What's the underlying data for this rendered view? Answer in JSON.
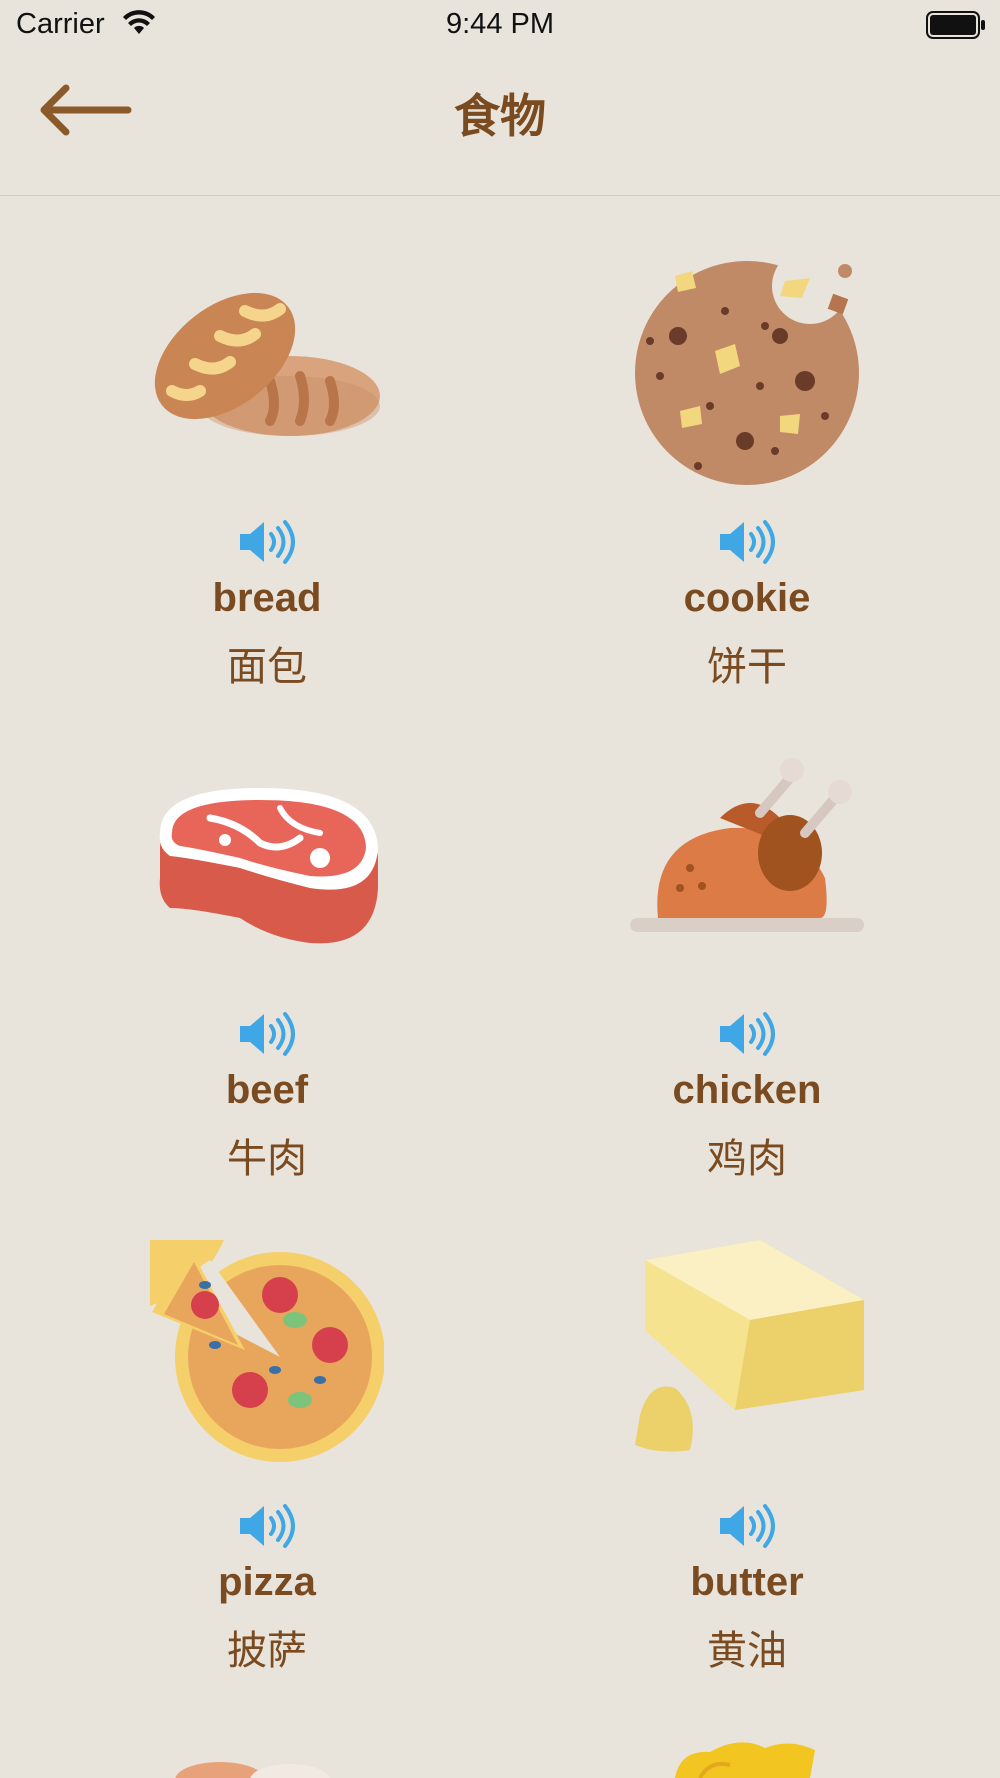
{
  "status_bar": {
    "carrier": "Carrier",
    "time": "9:44 PM"
  },
  "nav": {
    "title": "食物"
  },
  "items": [
    {
      "en": "bread",
      "zh": "面包",
      "icon": "bread-icon"
    },
    {
      "en": "cookie",
      "zh": "饼干",
      "icon": "cookie-icon"
    },
    {
      "en": "beef",
      "zh": "牛肉",
      "icon": "beef-icon"
    },
    {
      "en": "chicken",
      "zh": "鸡肉",
      "icon": "chicken-icon"
    },
    {
      "en": "pizza",
      "zh": "披萨",
      "icon": "pizza-icon"
    },
    {
      "en": "butter",
      "zh": "黄油",
      "icon": "butter-icon"
    }
  ],
  "colors": {
    "background": "#e9e4db",
    "text": "#7a4a20",
    "speaker": "#3fa7e6"
  }
}
